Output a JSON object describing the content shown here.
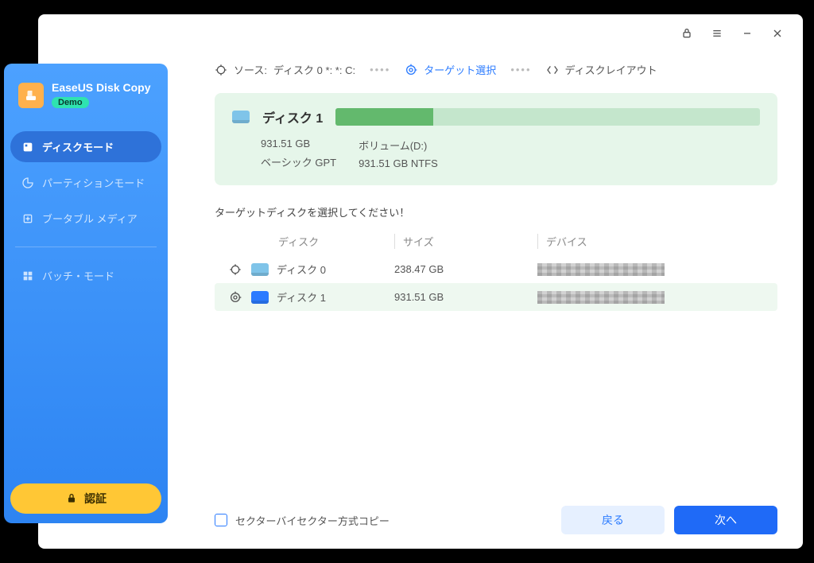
{
  "titlebar": {
    "lock": "lock",
    "menu": "menu",
    "min": "minimize",
    "close": "close"
  },
  "sidebar": {
    "title": "EaseUS Disk Copy",
    "badge": "Demo",
    "items": [
      {
        "label": "ディスクモード"
      },
      {
        "label": "パーティションモード"
      },
      {
        "label": "ブータブル メディア"
      },
      {
        "label": "バッチ・モード"
      }
    ],
    "auth_label": "認証"
  },
  "steps": {
    "source_prefix": "ソース:",
    "source_value": "ディスク 0 *: *: C:",
    "target_label": "ターゲット選択",
    "layout_label": "ディスクレイアウト"
  },
  "selected_disk": {
    "name": "ディスク 1",
    "size": "931.51 GB",
    "type": "ベーシック GPT",
    "volume_label": "ボリューム(D:)",
    "volume_detail": "931.51 GB NTFS",
    "fill_pct": 23
  },
  "prompt": "ターゲットディスクを選択してください！",
  "table": {
    "headers": {
      "disk": "ディスク",
      "size": "サイズ",
      "device": "デバイス"
    },
    "rows": [
      {
        "name": "ディスク 0",
        "size": "238.47 GB",
        "device": "████",
        "selected": false,
        "marker": "source"
      },
      {
        "name": "ディスク 1",
        "size": "931.51 GB",
        "device": "████",
        "selected": true,
        "marker": "target"
      }
    ]
  },
  "footer": {
    "checkbox_label": "セクターバイセクター方式コピー",
    "back": "戻る",
    "next": "次へ"
  }
}
